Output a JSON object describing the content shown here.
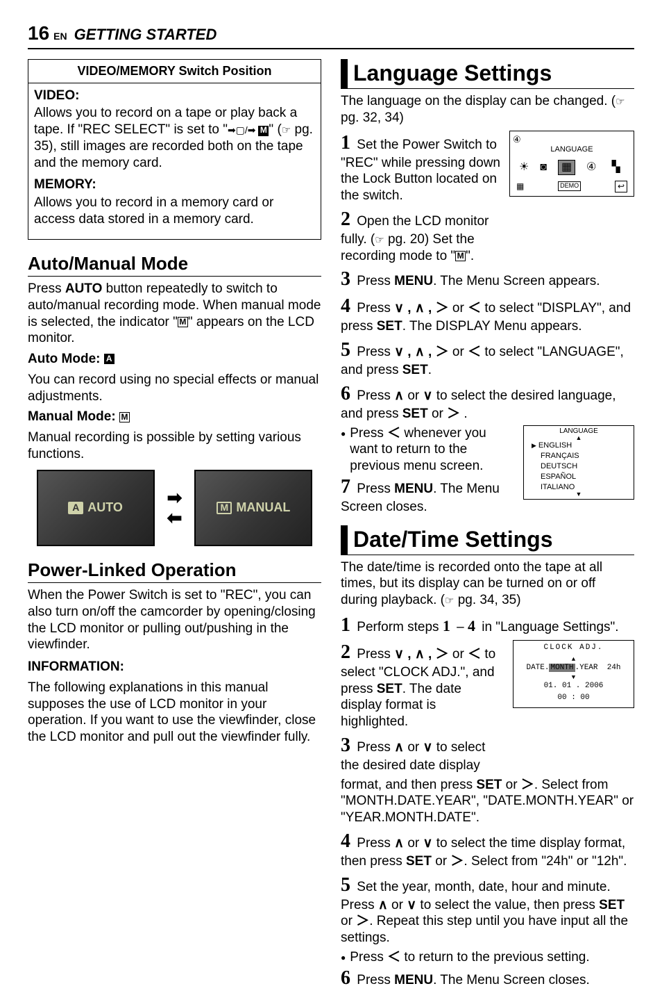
{
  "page": {
    "number": "16",
    "lang": "EN",
    "section": "GETTING STARTED"
  },
  "left": {
    "box_title": "VIDEO/MEMORY Switch Position",
    "video_h": "VIDEO:",
    "video_p1a": "Allows you to record on a tape or play back a tape. If \"REC SELECT\" is set to \"",
    "video_p1b": "\" (",
    "video_p1c": " pg. 35), still images are recorded both on the tape and the memory card.",
    "memory_h": "MEMORY:",
    "memory_p": "Allows you to record in a memory card or access data stored in a memory card.",
    "auto_manual_h": "Auto/Manual Mode",
    "auto_p1a": "Press ",
    "auto_p1b": "AUTO",
    "auto_p1c": " button repeatedly to switch to auto/manual recording mode. When manual mode is selected, the indicator \"",
    "auto_p1d": "\" appears on the LCD monitor.",
    "auto_mode_h": "Auto Mode: ",
    "auto_mode_p": "You can record using no special effects or manual adjustments.",
    "manual_mode_h": "Manual Mode: ",
    "manual_mode_p": "Manual recording is possible by setting various functions.",
    "lcd1": "AUTO",
    "lcd2": "MANUAL",
    "power_linked_h": "Power-Linked Operation",
    "power_linked_p": "When the Power Switch is set to \"REC\", you can also turn on/off the camcorder by opening/closing the LCD monitor or pulling out/pushing in the viewfinder.",
    "info_h": "INFORMATION:",
    "info_p": "The following explanations in this manual supposes the use of LCD monitor in your operation. If you want to use the viewfinder, close the LCD monitor and pull out the viewfinder fully."
  },
  "right": {
    "lang_h": "Language Settings",
    "lang_intro_a": "The language on the display can be changed. (",
    "lang_intro_b": " pg. 32, 34)",
    "s1": " Set the Power Switch to \"REC\" while pressing down the Lock Button located on the switch.",
    "s2a": " Open the LCD monitor fully. (",
    "s2b": " pg. 20) Set the recording mode to \"",
    "s2c": "\".",
    "s3a": " Press ",
    "s3b": "MENU",
    "s3c": ". The Menu Screen appears.",
    "s4a": " Press ",
    "s4b": " or ",
    "s4c": " to select \"DISPLAY\", and press ",
    "s4d": "SET",
    "s4e": ". The DISPLAY Menu appears.",
    "s5a": " Press ",
    "s5b": " or ",
    "s5c": " to select \"LANGUAGE\", and press ",
    "s5d": "SET",
    "s5e": ".",
    "s6a": " Press ",
    "s6b": " or ",
    "s6c": " to select the desired language, and press ",
    "s6d": "SET",
    "s6e": " or ",
    "s6f": " .",
    "s6_bullet": "Press   whenever you want to return to the previous menu screen.",
    "s7a": " Press ",
    "s7b": "MENU",
    "s7c": ". The Menu Screen closes.",
    "menu1_title": "LANGUAGE",
    "menu1_demo": "DEMO",
    "menu2_title": "LANGUAGE",
    "menu2_items": [
      "ENGLISH",
      "FRANÇAIS",
      "DEUTSCH",
      "ESPAÑOL",
      "ITALIANO"
    ],
    "date_h": "Date/Time Settings",
    "date_intro_a": "The date/time is recorded onto the tape at all times, but its display can be turned on or off during playback. (",
    "date_intro_b": " pg. 34, 35)",
    "d1a": " Perform steps ",
    "d1b": "1",
    "d1c": " – ",
    "d1d": "4",
    "d1e": " in \"Language Settings\".",
    "d2a": " Press ",
    "d2b": " or ",
    "d2c": " to select \"CLOCK ADJ.\", and press ",
    "d2d": "SET",
    "d2e": ". The date display format is highlighted.",
    "d3a": " Press ",
    "d3b": " or ",
    "d3c": " to select the desired date display format, and then press ",
    "d3d": "SET",
    "d3e": " or ",
    "d3f": ". Select from \"MONTH.DATE.YEAR\", \"DATE.MONTH.YEAR\" or \"YEAR.MONTH.DATE\".",
    "d4a": " Press ",
    "d4b": " or ",
    "d4c": " to select the time display format, then press ",
    "d4d": "SET",
    "d4e": " or ",
    "d4f": ". Select from \"24h\" or \"12h\".",
    "d5a": " Set the year, month, date, hour and minute. Press ",
    "d5b": " or ",
    "d5c": " to select the value, then press ",
    "d5d": "SET",
    "d5e": " or ",
    "d5f": ". Repeat this step until you have input all the settings.",
    "d5_bullet": "Press   to return to the previous setting.",
    "d6a": " Press ",
    "d6b": "MENU",
    "d6c": ". The Menu Screen closes.",
    "menu3_title": "CLOCK ADJ.",
    "menu3_line1a": "DATE.",
    "menu3_line1b": "MONTH",
    "menu3_line1c": ".YEAR",
    "menu3_line1d": "24h",
    "menu3_line2": "01. 01 . 2006",
    "menu3_line3": "00 : 00"
  }
}
